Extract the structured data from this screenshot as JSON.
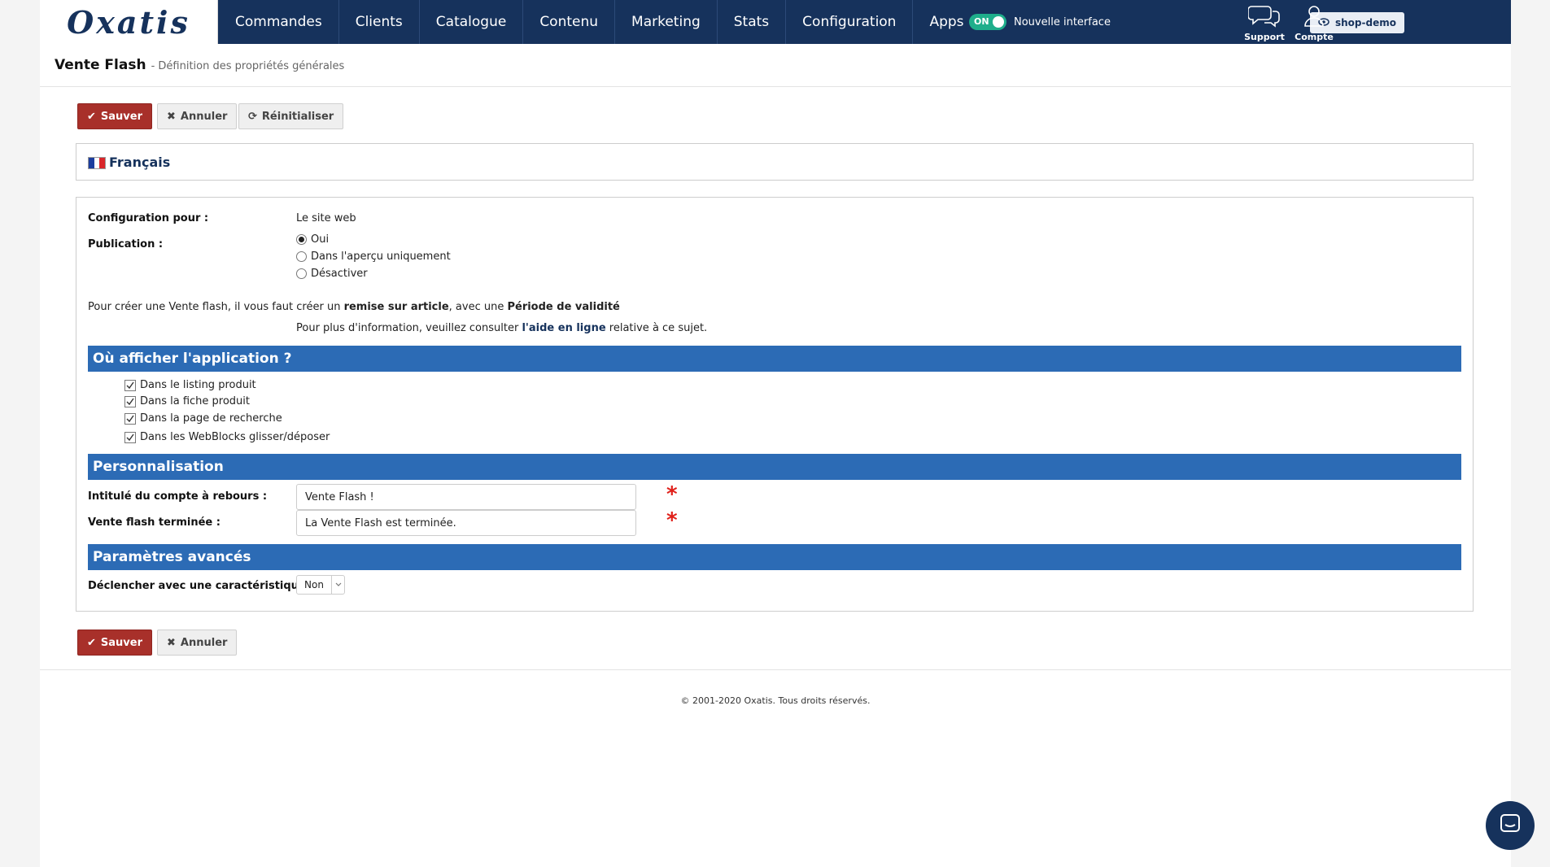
{
  "brand": {
    "logo": "Oxatis"
  },
  "nav": {
    "items": [
      "Commandes",
      "Clients",
      "Catalogue",
      "Contenu",
      "Marketing",
      "Stats",
      "Configuration",
      "Apps"
    ],
    "toggle_state": "ON",
    "toggle_label": "Nouvelle interface",
    "shop_label": "shop-demo",
    "support_label": "Support",
    "account_label": "Compte"
  },
  "header": {
    "title": "Vente Flash",
    "subtitle": "- Définition des propriétés générales"
  },
  "actions": {
    "save": "Sauver",
    "cancel": "Annuler",
    "reset": "Réinitialiser"
  },
  "language": {
    "label": "Français"
  },
  "form": {
    "config_label": "Configuration pour :",
    "config_value": "Le site web",
    "publication_label": "Publication :",
    "publication_options": [
      "Oui",
      "Dans l'aperçu uniquement",
      "Désactiver"
    ],
    "publication_selected": "Oui",
    "info1_pre": "Pour créer une Vente flash, il vous faut créer un ",
    "info1_b1": "remise sur article",
    "info1_mid": ", avec une ",
    "info1_b2": "Période de validité",
    "info2_pre": "Pour plus d'information, veuillez consulter ",
    "info2_link": "l'aide en ligne",
    "info2_post": " relative à ce sujet.",
    "section_where": "Où afficher l'application ?",
    "where_options": [
      "Dans le listing produit",
      "Dans la fiche produit",
      "Dans la page de recherche",
      "Dans les WebBlocks glisser/déposer"
    ],
    "section_perso": "Personnalisation",
    "countdown_label": "Intitulé du compte à rebours :",
    "countdown_value": "Vente Flash !",
    "ended_label": "Vente flash terminée :",
    "ended_value": "La Vente Flash est terminée.",
    "required_mark": "*",
    "section_advanced": "Paramètres avancés",
    "trigger_label": "Déclencher avec une caractéristique :",
    "trigger_value": "Non"
  },
  "footer": {
    "copyright": "© 2001-2020 Oxatis. Tous droits réservés."
  },
  "colors": {
    "nav_bg": "#16325c",
    "section_bar": "#2c6bb5",
    "save_button": "#a8302a",
    "toggle_on": "#1fae8b",
    "required": "#e0201a"
  }
}
